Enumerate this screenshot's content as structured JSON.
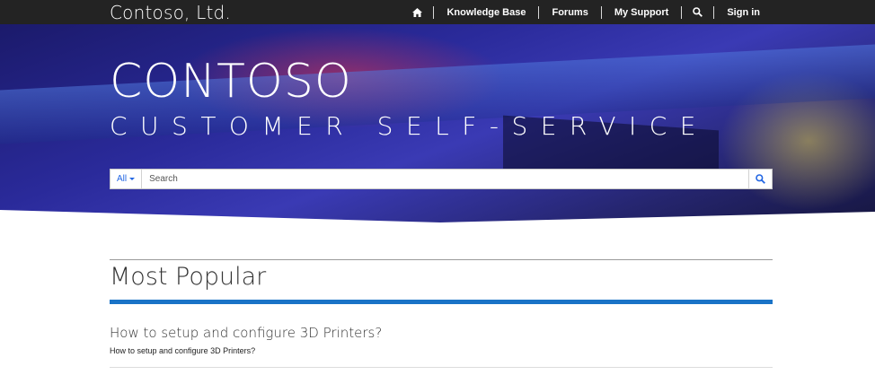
{
  "header": {
    "brand": "Contoso, Ltd.",
    "nav": [
      {
        "icon": "home-icon"
      },
      {
        "label": "Knowledge Base"
      },
      {
        "label": "Forums"
      },
      {
        "label": "My Support"
      },
      {
        "icon": "search-icon"
      },
      {
        "label": "Sign in"
      }
    ]
  },
  "hero": {
    "title": "CONTOSO",
    "subtitle": "CUSTOMER SELF-SERVICE",
    "search": {
      "scope": "All",
      "placeholder": "Search",
      "button_icon": "search-icon"
    }
  },
  "main": {
    "section_title": "Most Popular",
    "articles": [
      {
        "title": "How to setup and configure 3D Printers?",
        "description": "How to setup and configure 3D Printers?"
      }
    ]
  },
  "colors": {
    "topbar": "#232323",
    "accent": "#1a73c7",
    "link_blue": "#2266e3"
  }
}
